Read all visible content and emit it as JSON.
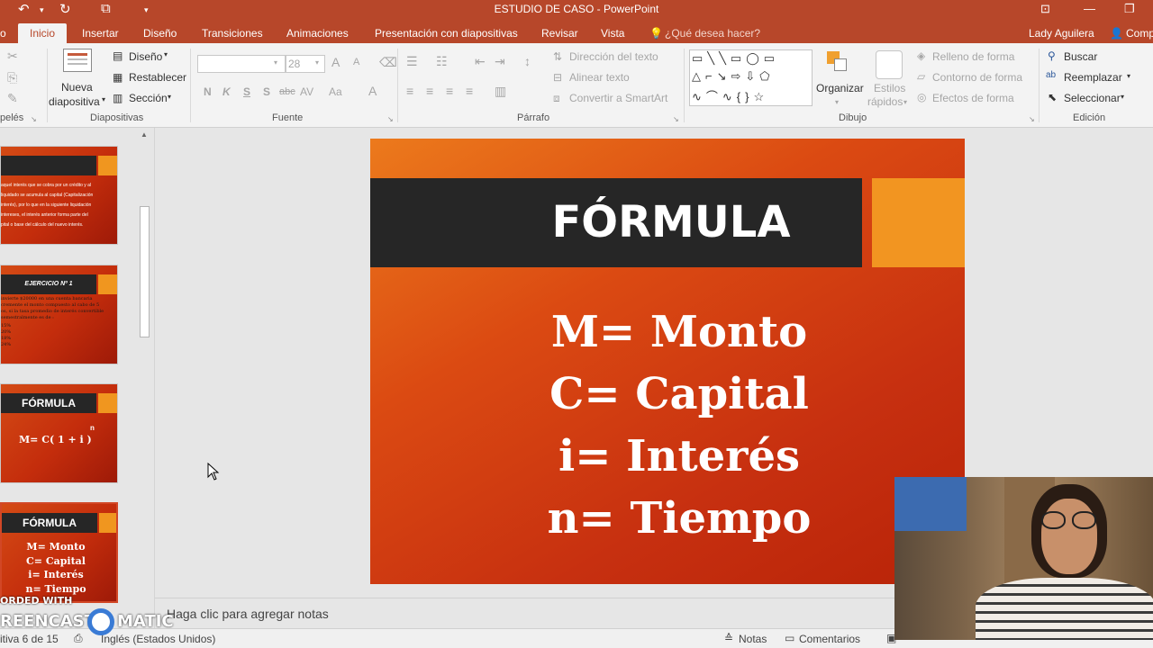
{
  "window": {
    "title": "ESTUDIO DE CASO - PowerPoint"
  },
  "tabs": [
    "o",
    "Inicio",
    "Insertar",
    "Diseño",
    "Transiciones",
    "Animaciones",
    "Presentación con diapositivas",
    "Revisar",
    "Vista"
  ],
  "tell_me": "¿Qué desea hacer?",
  "user": "Lady Aguilera",
  "share": "Comp",
  "ribbon": {
    "slides": {
      "new_slide": "Nueva",
      "new_slide2": "diapositiva",
      "layout": "Diseño",
      "reset": "Restablecer",
      "section": "Sección",
      "group": "Diapositivas"
    },
    "clipboard_group": "pelés",
    "font": {
      "name": "",
      "size": "28",
      "bold": "N",
      "italic": "K",
      "underline": "S",
      "shadow": "S",
      "strike": "abc",
      "spacing": "AV",
      "case": "Aa",
      "color": "A",
      "grow": "A",
      "shrink": "A",
      "group": "Fuente"
    },
    "paragraph": {
      "text_direction": "Dirección del texto",
      "align_text": "Alinear texto",
      "smartart": "Convertir a SmartArt",
      "group": "Párrafo"
    },
    "drawing": {
      "arrange": "Organizar",
      "quick_styles": "Estilos",
      "quick_styles2": "rápidos",
      "fill": "Relleno de forma",
      "outline": "Contorno de forma",
      "effects": "Efectos de forma",
      "group": "Dibujo"
    },
    "editing": {
      "find": "Buscar",
      "replace": "Reemplazar",
      "select": "Seleccionar",
      "group": "Edición"
    }
  },
  "thumbnails": [
    {
      "lines": [
        "aquel interés que se cobra por un crédito y al",
        "liquidado se acumula al capital (Capitalización",
        "interés), por lo que en la siguiente liquidación",
        "intereses, el interés anterior forma parte del",
        "pital o base del cálculo del nuevo interés."
      ]
    },
    {
      "title": "EJERCICIO Nº 1",
      "lines": [
        "invierte $20000 en una cuenta bancaria",
        "cremente el monto compuesto al cabo de 5",
        "os, si la tasa promedio de interés convertible",
        "semestralmente es de :",
        "15%",
        "20%",
        "18%",
        "24%"
      ]
    },
    {
      "title": "FÓRMULA",
      "formula": "M= C( 1 + i )",
      "exp": "n"
    },
    {
      "title": "FÓRMULA",
      "lines": [
        "M= Monto",
        "C= Capital",
        "i= Interés",
        "n= Tiempo"
      ]
    }
  ],
  "slide": {
    "title": "FÓRMULA",
    "lines": [
      "M= Monto",
      "C= Capital",
      "i= Interés",
      "n= Tiempo"
    ]
  },
  "notes_placeholder": "Haga clic para agregar notas",
  "status": {
    "slide_count": "itiva 6 de 15",
    "language": "Inglés (Estados Unidos)",
    "notes": "Notas",
    "comments": "Comentarios"
  },
  "watermark": {
    "line1": "ORDED WITH",
    "line2": "REENCAST",
    "line3": "MATIC"
  }
}
